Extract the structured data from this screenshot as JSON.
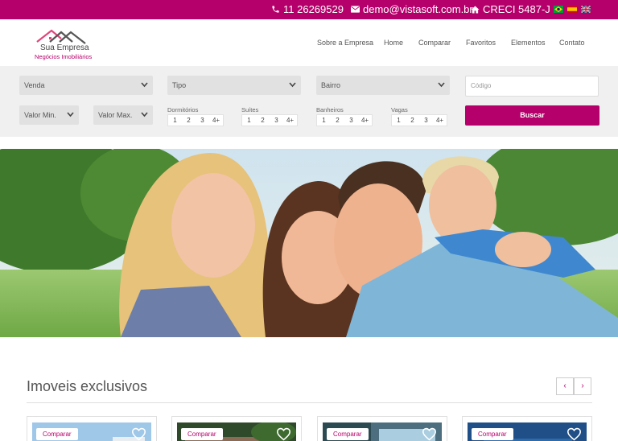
{
  "topbar": {
    "phone": "11 26269529",
    "email": "demo@vistasoft.com.br",
    "creci": "CRECI 5487-J",
    "languages": [
      "pt-br-flag",
      "es-flag",
      "uk-flag"
    ]
  },
  "brand": {
    "name": "Sua Empresa",
    "tagline": "Negócios Imobiliários",
    "accent": "#b5006b"
  },
  "nav": [
    "Sobre a Empresa",
    "Home",
    "Comparar",
    "Favoritos",
    "Elementos",
    "Contato"
  ],
  "search": {
    "finalidade": "Venda",
    "tipo": "Tipo",
    "bairro": "Bairro",
    "codigo_placeholder": "Código",
    "valor_min": "Valor Min.",
    "valor_max": "Valor Max.",
    "groups": [
      {
        "label": "Dormitórios",
        "options": [
          "1",
          "2",
          "3",
          "4+"
        ]
      },
      {
        "label": "Suítes",
        "options": [
          "1",
          "2",
          "3",
          "4+"
        ]
      },
      {
        "label": "Banheiros",
        "options": [
          "1",
          "2",
          "3",
          "4+"
        ]
      },
      {
        "label": "Vagas",
        "options": [
          "1",
          "2",
          "3",
          "4+"
        ]
      }
    ],
    "submit": "Buscar"
  },
  "section": {
    "title": "Imoveis exclusivos",
    "prev": "‹",
    "next": "›"
  },
  "cards": [
    {
      "compare": "Comparar"
    },
    {
      "compare": "Comparar"
    },
    {
      "compare": "Comparar"
    },
    {
      "compare": "Comparar"
    }
  ]
}
